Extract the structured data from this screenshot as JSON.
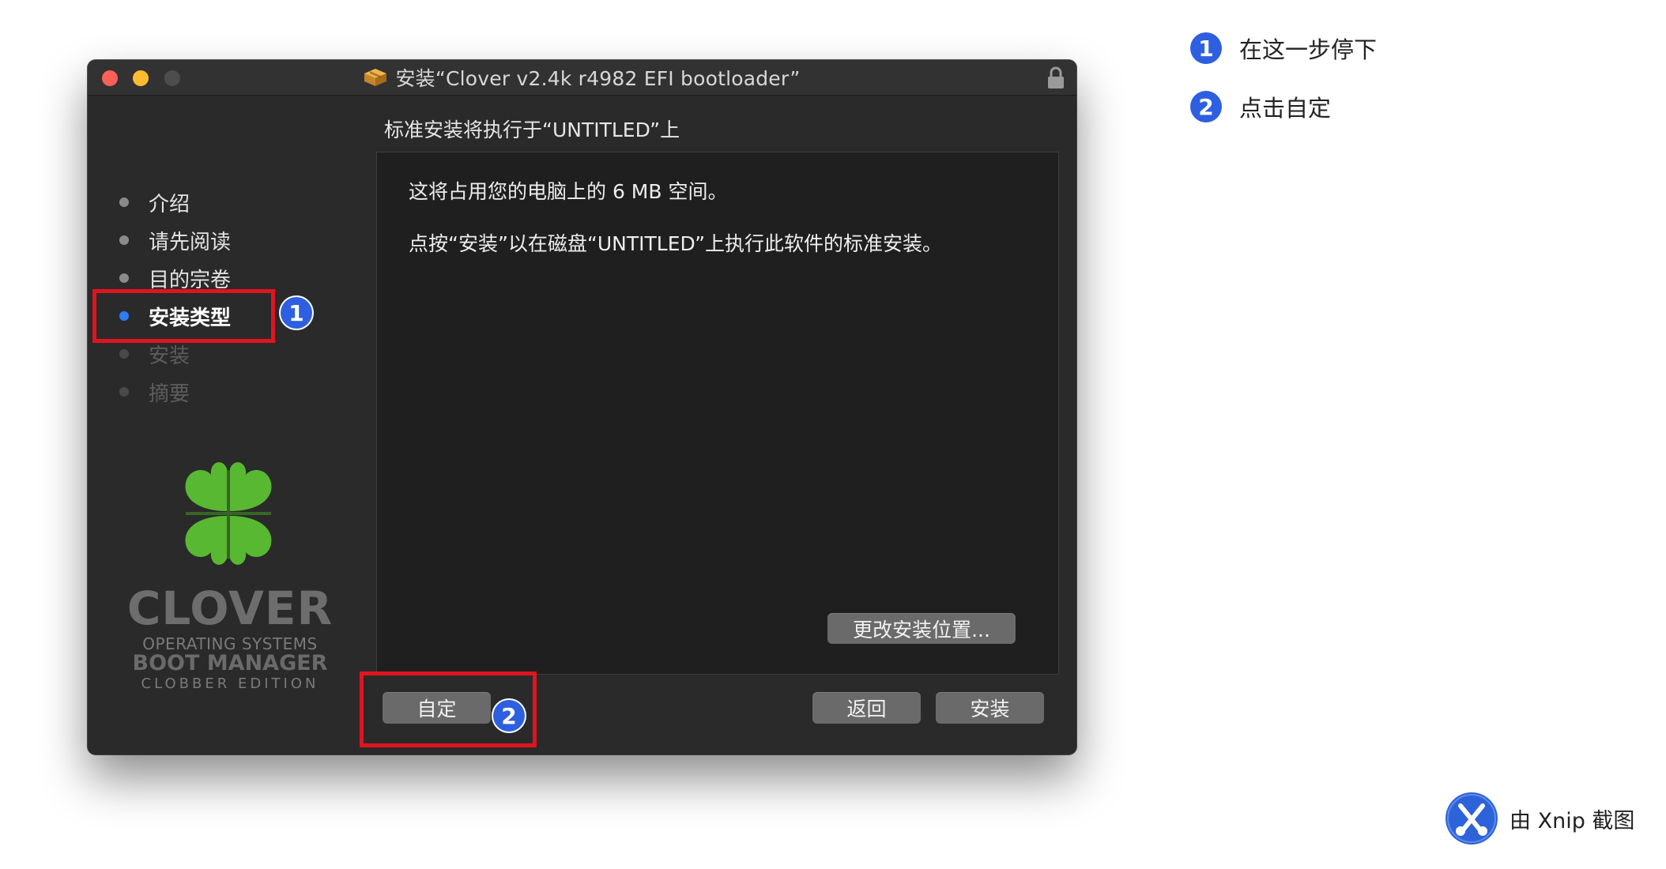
{
  "window": {
    "title": "安装“Clover v2.4k r4982 EFI bootloader”",
    "subtitle": "标准安装将执行于“UNTITLED”上"
  },
  "sidebar": {
    "steps": [
      {
        "label": "介绍",
        "state": "done"
      },
      {
        "label": "请先阅读",
        "state": "done"
      },
      {
        "label": "目的宗卷",
        "state": "done"
      },
      {
        "label": "安装类型",
        "state": "current"
      },
      {
        "label": "安装",
        "state": "future"
      },
      {
        "label": "摘要",
        "state": "future"
      }
    ],
    "brand": {
      "name": "CLOVER",
      "line1": "OPERATING SYSTEMS",
      "line2": "BOOT MANAGER",
      "line3": "CLOBBER EDITION"
    }
  },
  "main": {
    "message1": "这将占用您的电脑上的 6 MB 空间。",
    "message2": "点按“安装”以在磁盘“UNTITLED”上执行此软件的标准安装。",
    "change_location_label": "更改安装位置..."
  },
  "footer": {
    "customize_label": "自定",
    "back_label": "返回",
    "install_label": "安装"
  },
  "annotations": {
    "badge1": "1",
    "badge2": "2",
    "legend": [
      {
        "num": "1",
        "text": "在这一步停下"
      },
      {
        "num": "2",
        "text": "点击自定"
      }
    ]
  },
  "watermark": {
    "text": "由 Xnip 截图"
  },
  "colors": {
    "accent": "#2f7cf6",
    "highlight": "#e0141f",
    "badge": "#2d5fe0",
    "window_bg": "#2a2a2a",
    "clover_green": "#58b832"
  },
  "icons": [
    "package-icon",
    "lock-icon",
    "clover-logo-icon",
    "xnip-icon"
  ]
}
